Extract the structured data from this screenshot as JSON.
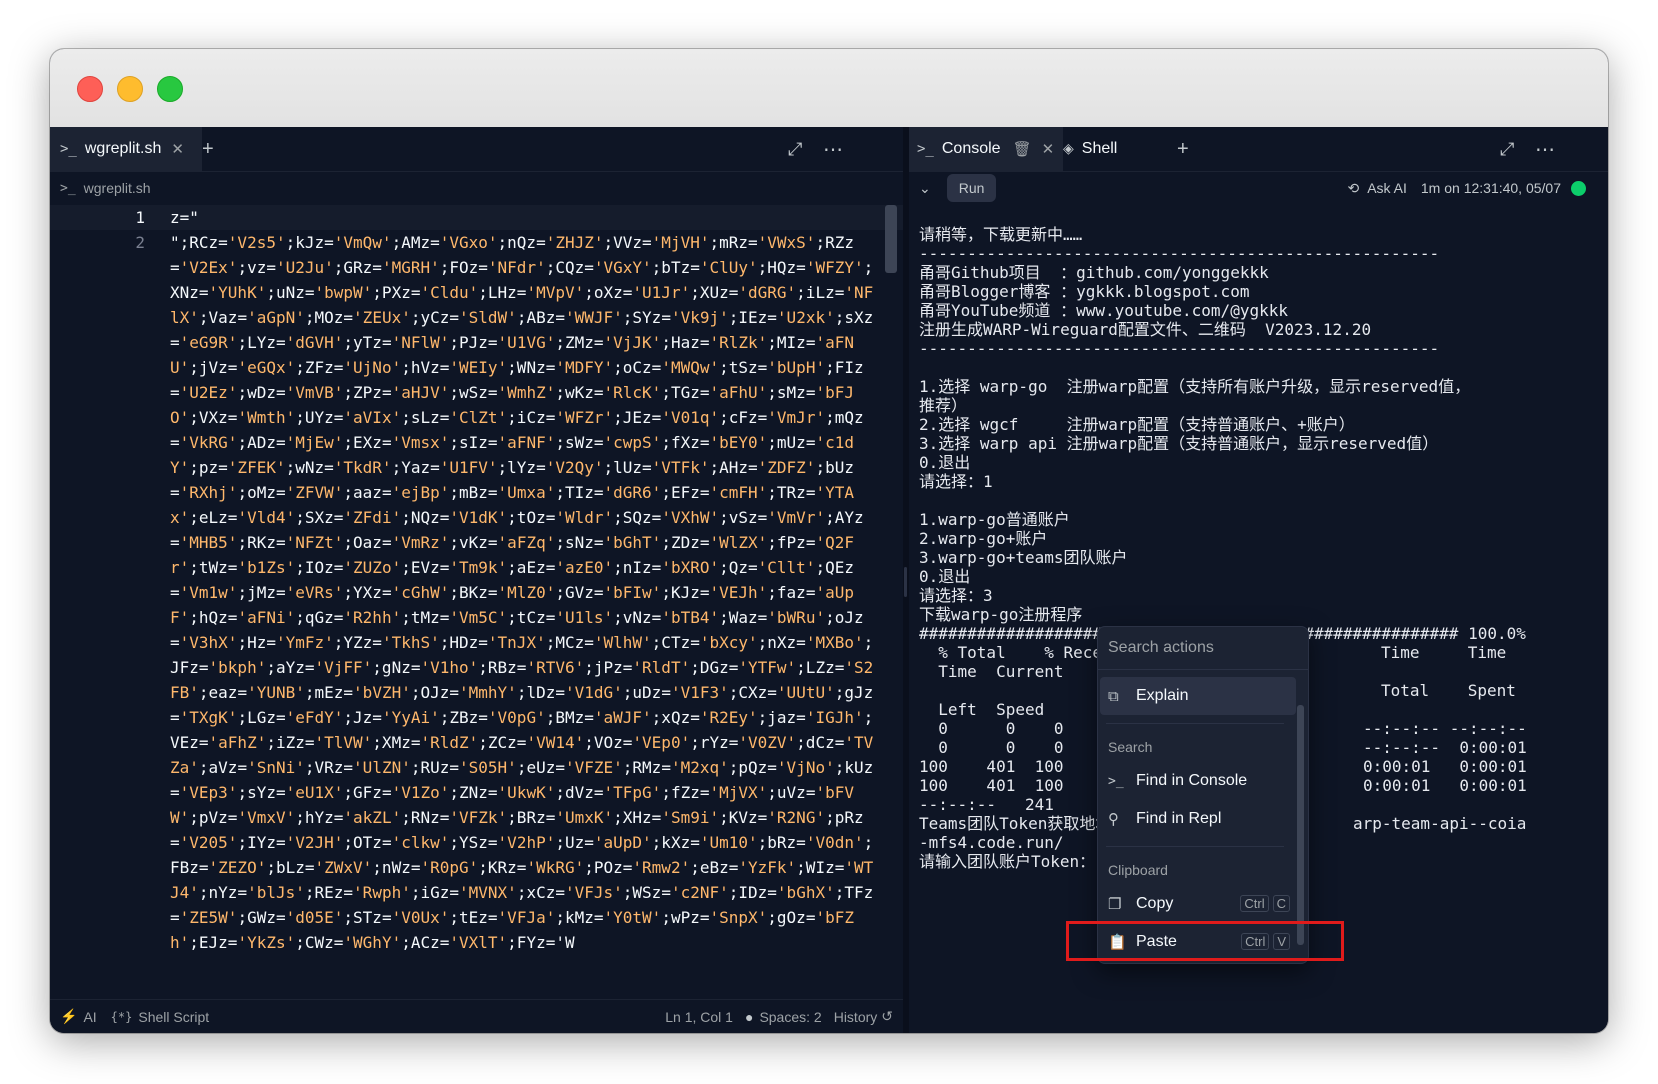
{
  "editor": {
    "tab_label": "wgreplit.sh",
    "breadcrumb": "wgreplit.sh",
    "line_numbers": [
      "1",
      "2"
    ],
    "code_text": "z=\"\n\";RCz='V2s5';kJz='VmQw';AMz='VGxo';nQz='ZHJZ';VVz='MjVH';mRz='VWxS';RZz='V2Ex';vz='U2Ju';GRz='MGRH';FOz='NFdr';CQz='VGxY';bTz='ClUy';HQz='WFZY';XNz='YUhK';uNz='bwpW';PXz='Cldu';LHz='MVpV';oXz='U1Jr';XUz='dGRG';iLz='NFlX';Vaz='aGpN';MOz='ZEUx';yCz='SldW';ABz='WWJF';SYz='Vk9j';IEz='U2xk';sXz='eG9R';LYz='dGVH';yTz='NFlW';PJz='U1VG';ZMz='VjJK';Haz='RlZk';MIz='aFNU';jVz='eGQx';ZFz='UjNo';hVz='WEIy';WNz='MDFY';oCz='MWQw';tSz='bUpH';FIz='U2Ez';wDz='VmVB';ZPz='aHJV';wSz='WmhZ';wKz='RlcK';TGz='aFhU';sMz='bFJO';VXz='Wmth';UYz='aVIx';sLz='ClZt';iCz='WFZr';JEz='V01q';cFz='VmJr';mQz='VkRG';ADz='MjEw';EXz='Vmsx';sIz='aFNF';sWz='cwpS';fXz='bEY0';mUz='c1dY';pz='ZFEK';wNz='TkdR';Yaz='U1FV';lYz='V2Qy';lUz='VTFk';AHz='ZDFZ';bUz='RXhj';oMz='ZFVW';aaz='ejBp';mBz='Umxa';TIz='dGR6';EFz='cmFH';TRz='YTAx';eLz='Vld4';SXz='ZFdi';NQz='V1dK';tOz='Wldr';SQz='VXhW';vSz='VmVr';AYz='MHB5';RKz='NFZt';Oaz='VmRz';vKz='aFZq';sNz='bGhT';ZDz='WlZX';fPz='Q2Fr';tWz='b1Zs';IOz='ZUZo';EVz='Tm9k';aEz='azE0';nIz='bXRO';Qz='Cllt';QEz='Vm1w';jMz='eVRs';YXz='cGhW';BKz='MlZ0';GVz='bFIw';KJz='VEJh';faz='aUpF';hQz='aFNi';qGz='R2hh';tMz='Vm5C';tCz='U1ls';vNz='bTB4';Waz='bWRu';oJz='V3hX';Hz='YmFz';YZz='TkhS';HDz='TnJX';MCz='WlhW';CTz='bXcy';nXz='MXBo';JFz='bkph';aYz='VjFF';gNz='V1ho';RBz='RTV6';jPz='RldT';DGz='YTFw';LZz='S2FB';eaz='YUNB';mEz='bVZH';OJz='MmhY';lDz='V1dG';uDz='V1F3';CXz='UUtU';gJz='TXgK';LGz='eFdY';Jz='YyAi';ZBz='V0pG';BMz='aWJF';xQz='R2Ey';jaz='IGJh';VEz='aFhZ';iZz='TlVW';XMz='RldZ';ZCz='VW14';VOz='VEp0';rYz='V0ZV';dCz='TVZa';aVz='SnNi';VRz='UlZN';RUz='S05H';eUz='VFZE';RMz='M2xq';pQz='VjNo';kUz='VEp3';sYz='eU1X';GFz='V1Zo';ZNz='UkwK';dVz='TFpG';fZz='MjVX';uVz='bFVW';pVz='VmxV';hYz='akZL';RNz='VFZk';BRz='UmxK';XHz='Sm9i';KVz='R2NG';pRz='V205';IYz='V2JH';OTz='clkw';YSz='V2hP';Uz='aUpD';kXz='Um10';bRz='V0dn';FBz='ZEZO';bLz='ZWxV';nWz='R0pG';KRz='WkRG';POz='Rmw2';eBz='YzFk';WIz='WTJ4';nYz='blJs';REz='Rwph';iGz='MVNX';xCz='VFJs';WSz='c2NF';IDz='bGhX';TFz='ZE5W';GWz='d05E';STz='V0Ux';tEz='VFJa';kMz='Y0tW';wPz='SnpX';gOz='bFZh';EJz='YkZs';CWz='WGhY';ACz='VXlT';FYz='W"
  },
  "editor_toolbar": {
    "expand_icon": "⤢",
    "more_icon": "⋯",
    "add_tab": "+"
  },
  "status": {
    "ai": "AI",
    "language": "Shell Script",
    "cursor": "Ln 1, Col 1",
    "spaces": "Spaces: 2",
    "history": "History"
  },
  "console": {
    "tab_console": "Console",
    "tab_shell": "Shell",
    "run_label": "Run",
    "ask_ai": "Ask AI",
    "run_info": "1m on 12:31:40, 05/07",
    "status_color": "#0cce6b",
    "output_lines": [
      "请稍等，下载更新中……",
      "------------------------------------------------------",
      "甬哥Github项目  ：github.com/yonggekkk",
      "甬哥Blogger博客 ：ygkkk.blogspot.com",
      "甬哥YouTube频道 ：www.youtube.com/@ygkkk",
      "注册生成WARP-Wireguard配置文件、二维码  V2023.12.20",
      "------------------------------------------------------",
      "",
      "1.选择 warp-go  注册warp配置（支持所有账户升级，显示reserved值，",
      "推荐）",
      "2.选择 wgcf     注册warp配置（支持普通账户、+账户）",
      "3.选择 warp api 注册warp配置（支持普通账户，显示reserved值）",
      "0.退出",
      "请选择：1",
      "",
      "1.warp-go普通账户",
      "2.warp-go+账户",
      "3.warp-go+teams团队账户",
      "0.退出",
      "请选择：3",
      "下载warp-go注册程序",
      "######################################################## 100.0%",
      "  % Total    % Received",
      "  Time  Current",
      "",
      "  Left  Speed",
      "  0      0    0      0",
      "  0      0    0      0",
      "100    401  100    401",
      "100    401  100    401",
      "--:--:--   241",
      "Teams团队Token获取地址：",
      "-mfs4.code.run/",
      "请输入团队账户Token：▯"
    ],
    "output_right": {
      "header1": "Time     Time",
      "header2": "Total    Spent",
      "r1": "--:--:-- --:--:--",
      "r2": "--:--:--  0:00:01",
      "r3": "0:00:01   0:00:01",
      "r4": "0:00:01   0:00:01",
      "teams": "arp-team-api--coia"
    }
  },
  "context_menu": {
    "search_placeholder": "Search actions",
    "explain": "Explain",
    "section_search": "Search",
    "find_console": "Find in Console",
    "find_repl": "Find in Repl",
    "section_clipboard": "Clipboard",
    "copy": "Copy",
    "copy_mod": "Ctrl",
    "copy_key": "C",
    "paste": "Paste",
    "paste_mod": "Ctrl",
    "paste_key": "V"
  },
  "highlight_color": "#e01b1b"
}
